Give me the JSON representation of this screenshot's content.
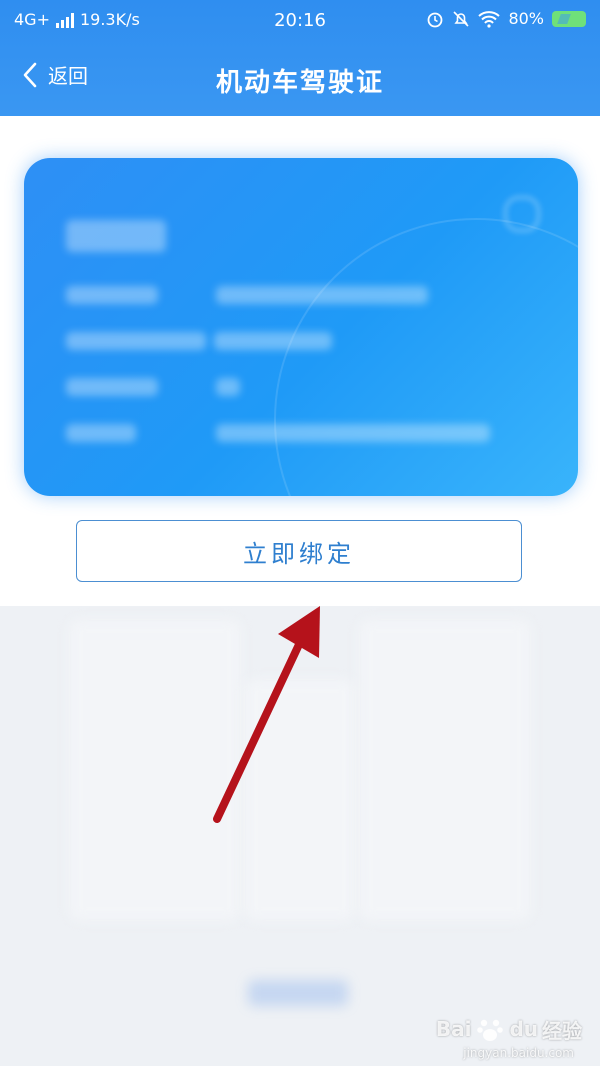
{
  "status_bar": {
    "network": "4G+",
    "speed": "19.3K/s",
    "time": "20:16",
    "battery": "80%",
    "icons": [
      "signal-icon",
      "alarm-icon",
      "mute-icon",
      "wifi-icon",
      "battery-icon"
    ]
  },
  "nav": {
    "back_label": "返回",
    "title": "机动车驾驶证"
  },
  "card": {
    "state": "blurred"
  },
  "bind_button": {
    "label": "立即绑定"
  },
  "annotation": {
    "arrow_color": "#b5121b",
    "arrow_target": "bind-button"
  },
  "watermark": {
    "brand": "Bai",
    "brand2": "du",
    "suffix": "经验",
    "url": "jingyan.baidu.com"
  },
  "colors": {
    "header": "#3a97f2",
    "card": "#1f9af7",
    "button_text": "#2f7fcf"
  }
}
